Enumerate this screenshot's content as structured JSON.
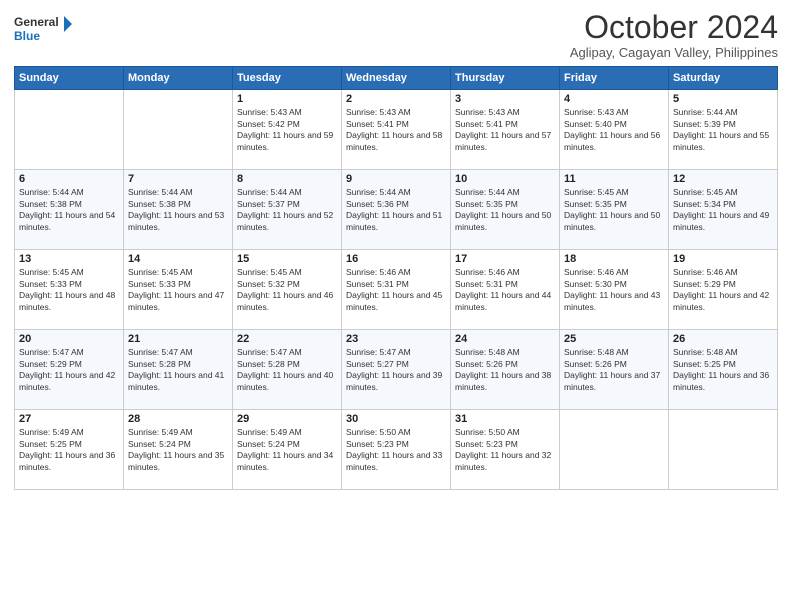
{
  "header": {
    "logo_line1": "General",
    "logo_line2": "Blue",
    "month": "October 2024",
    "location": "Aglipay, Cagayan Valley, Philippines"
  },
  "days_of_week": [
    "Sunday",
    "Monday",
    "Tuesday",
    "Wednesday",
    "Thursday",
    "Friday",
    "Saturday"
  ],
  "weeks": [
    [
      {
        "day": "",
        "info": ""
      },
      {
        "day": "",
        "info": ""
      },
      {
        "day": "1",
        "info": "Sunrise: 5:43 AM\nSunset: 5:42 PM\nDaylight: 11 hours and 59 minutes."
      },
      {
        "day": "2",
        "info": "Sunrise: 5:43 AM\nSunset: 5:41 PM\nDaylight: 11 hours and 58 minutes."
      },
      {
        "day": "3",
        "info": "Sunrise: 5:43 AM\nSunset: 5:41 PM\nDaylight: 11 hours and 57 minutes."
      },
      {
        "day": "4",
        "info": "Sunrise: 5:43 AM\nSunset: 5:40 PM\nDaylight: 11 hours and 56 minutes."
      },
      {
        "day": "5",
        "info": "Sunrise: 5:44 AM\nSunset: 5:39 PM\nDaylight: 11 hours and 55 minutes."
      }
    ],
    [
      {
        "day": "6",
        "info": "Sunrise: 5:44 AM\nSunset: 5:38 PM\nDaylight: 11 hours and 54 minutes."
      },
      {
        "day": "7",
        "info": "Sunrise: 5:44 AM\nSunset: 5:38 PM\nDaylight: 11 hours and 53 minutes."
      },
      {
        "day": "8",
        "info": "Sunrise: 5:44 AM\nSunset: 5:37 PM\nDaylight: 11 hours and 52 minutes."
      },
      {
        "day": "9",
        "info": "Sunrise: 5:44 AM\nSunset: 5:36 PM\nDaylight: 11 hours and 51 minutes."
      },
      {
        "day": "10",
        "info": "Sunrise: 5:44 AM\nSunset: 5:35 PM\nDaylight: 11 hours and 50 minutes."
      },
      {
        "day": "11",
        "info": "Sunrise: 5:45 AM\nSunset: 5:35 PM\nDaylight: 11 hours and 50 minutes."
      },
      {
        "day": "12",
        "info": "Sunrise: 5:45 AM\nSunset: 5:34 PM\nDaylight: 11 hours and 49 minutes."
      }
    ],
    [
      {
        "day": "13",
        "info": "Sunrise: 5:45 AM\nSunset: 5:33 PM\nDaylight: 11 hours and 48 minutes."
      },
      {
        "day": "14",
        "info": "Sunrise: 5:45 AM\nSunset: 5:33 PM\nDaylight: 11 hours and 47 minutes."
      },
      {
        "day": "15",
        "info": "Sunrise: 5:45 AM\nSunset: 5:32 PM\nDaylight: 11 hours and 46 minutes."
      },
      {
        "day": "16",
        "info": "Sunrise: 5:46 AM\nSunset: 5:31 PM\nDaylight: 11 hours and 45 minutes."
      },
      {
        "day": "17",
        "info": "Sunrise: 5:46 AM\nSunset: 5:31 PM\nDaylight: 11 hours and 44 minutes."
      },
      {
        "day": "18",
        "info": "Sunrise: 5:46 AM\nSunset: 5:30 PM\nDaylight: 11 hours and 43 minutes."
      },
      {
        "day": "19",
        "info": "Sunrise: 5:46 AM\nSunset: 5:29 PM\nDaylight: 11 hours and 42 minutes."
      }
    ],
    [
      {
        "day": "20",
        "info": "Sunrise: 5:47 AM\nSunset: 5:29 PM\nDaylight: 11 hours and 42 minutes."
      },
      {
        "day": "21",
        "info": "Sunrise: 5:47 AM\nSunset: 5:28 PM\nDaylight: 11 hours and 41 minutes."
      },
      {
        "day": "22",
        "info": "Sunrise: 5:47 AM\nSunset: 5:28 PM\nDaylight: 11 hours and 40 minutes."
      },
      {
        "day": "23",
        "info": "Sunrise: 5:47 AM\nSunset: 5:27 PM\nDaylight: 11 hours and 39 minutes."
      },
      {
        "day": "24",
        "info": "Sunrise: 5:48 AM\nSunset: 5:26 PM\nDaylight: 11 hours and 38 minutes."
      },
      {
        "day": "25",
        "info": "Sunrise: 5:48 AM\nSunset: 5:26 PM\nDaylight: 11 hours and 37 minutes."
      },
      {
        "day": "26",
        "info": "Sunrise: 5:48 AM\nSunset: 5:25 PM\nDaylight: 11 hours and 36 minutes."
      }
    ],
    [
      {
        "day": "27",
        "info": "Sunrise: 5:49 AM\nSunset: 5:25 PM\nDaylight: 11 hours and 36 minutes."
      },
      {
        "day": "28",
        "info": "Sunrise: 5:49 AM\nSunset: 5:24 PM\nDaylight: 11 hours and 35 minutes."
      },
      {
        "day": "29",
        "info": "Sunrise: 5:49 AM\nSunset: 5:24 PM\nDaylight: 11 hours and 34 minutes."
      },
      {
        "day": "30",
        "info": "Sunrise: 5:50 AM\nSunset: 5:23 PM\nDaylight: 11 hours and 33 minutes."
      },
      {
        "day": "31",
        "info": "Sunrise: 5:50 AM\nSunset: 5:23 PM\nDaylight: 11 hours and 32 minutes."
      },
      {
        "day": "",
        "info": ""
      },
      {
        "day": "",
        "info": ""
      }
    ]
  ]
}
